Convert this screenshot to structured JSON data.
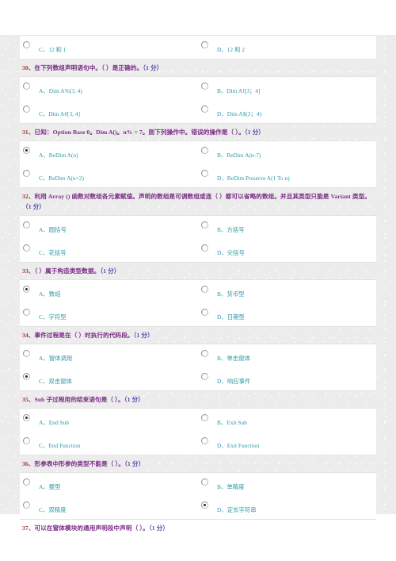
{
  "colors": {
    "question_number": "#9e3b2f",
    "question_text": "#7b2d86",
    "score": "#5a43b0",
    "option_text": "#2f9aa8",
    "paper_bg": "#ececec",
    "panel_bg": "#ffffff"
  },
  "partial_top": {
    "options": [
      {
        "label": "C、12 和 1",
        "checked": false
      },
      {
        "label": "D、12 和 2",
        "checked": false
      }
    ]
  },
  "questions": [
    {
      "number": "30、",
      "text": "在下列数组声明语句中。（   ）是正确的。",
      "score": "（1 分）",
      "options": [
        {
          "label": "A、Dim A%(3, 4)",
          "checked": false
        },
        {
          "label": "B、Dim A![3；4]",
          "checked": false
        },
        {
          "label": "C、Dim A#[3, 4]",
          "checked": false
        },
        {
          "label": "D、Dim A$(3；4)",
          "checked": false
        }
      ]
    },
    {
      "number": "31、",
      "text": "已知：Option Base 0。Dim A()。n% = 7。则下列操作中。错误的操作是（   ）。",
      "score": "（1 分）",
      "options": [
        {
          "label": "A、ReDim A(n)",
          "checked": true
        },
        {
          "label": "B、ReDim A(n-7)",
          "checked": false
        },
        {
          "label": "C、ReDim A(n+2)",
          "checked": false
        },
        {
          "label": "D、ReDim Preserve A(1 To n)",
          "checked": false
        }
      ]
    },
    {
      "number": "32、",
      "text": "利用 Array () 函数对数组各元素赋值。声明的数组是可调数组或连（   ）都可以省略的数组。并且其类型只能是 Variant 类型。",
      "score": "（1 分）",
      "options": [
        {
          "label": "A、圆括号",
          "checked": false
        },
        {
          "label": "B、方括号",
          "checked": false
        },
        {
          "label": "C、花括号",
          "checked": false
        },
        {
          "label": "D、尖括号",
          "checked": false
        }
      ]
    },
    {
      "number": "33、",
      "text": "（   ）属于构造类型数据。",
      "score": "（1 分）",
      "options": [
        {
          "label": "A、数组",
          "checked": true
        },
        {
          "label": "B、货币型",
          "checked": false
        },
        {
          "label": "C、字符型",
          "checked": false
        },
        {
          "label": "D、日期型",
          "checked": false
        }
      ]
    },
    {
      "number": "34、",
      "text": "事件过程是在（   ）时执行的代码段。",
      "score": "（1 分）",
      "options": [
        {
          "label": "A、窗体调用",
          "checked": false
        },
        {
          "label": "B、单击窗体",
          "checked": false
        },
        {
          "label": "C、双击窗体",
          "checked": true
        },
        {
          "label": "D、响应事件",
          "checked": false
        }
      ]
    },
    {
      "number": "35、",
      "text": "Sub 子过程用的结束语句是（   ）。",
      "score": "（1 分）",
      "options": [
        {
          "label": "A、End Sub",
          "checked": true
        },
        {
          "label": "B、Exit Sub",
          "checked": false
        },
        {
          "label": "C、End Function",
          "checked": false
        },
        {
          "label": "D、Exit Function",
          "checked": false
        }
      ]
    },
    {
      "number": "36、",
      "text": "形参表中形参的类型不能是（   ）。",
      "score": "（1 分）",
      "options": [
        {
          "label": "A、整型",
          "checked": false
        },
        {
          "label": "B、单精度",
          "checked": false
        },
        {
          "label": "C、双精度",
          "checked": false
        },
        {
          "label": "D、定长字符串",
          "checked": true
        }
      ]
    },
    {
      "number": "37、",
      "text": "可以在窗体模块的通用声明段中声明（   ）。",
      "score": "（1 分）",
      "options": []
    }
  ]
}
